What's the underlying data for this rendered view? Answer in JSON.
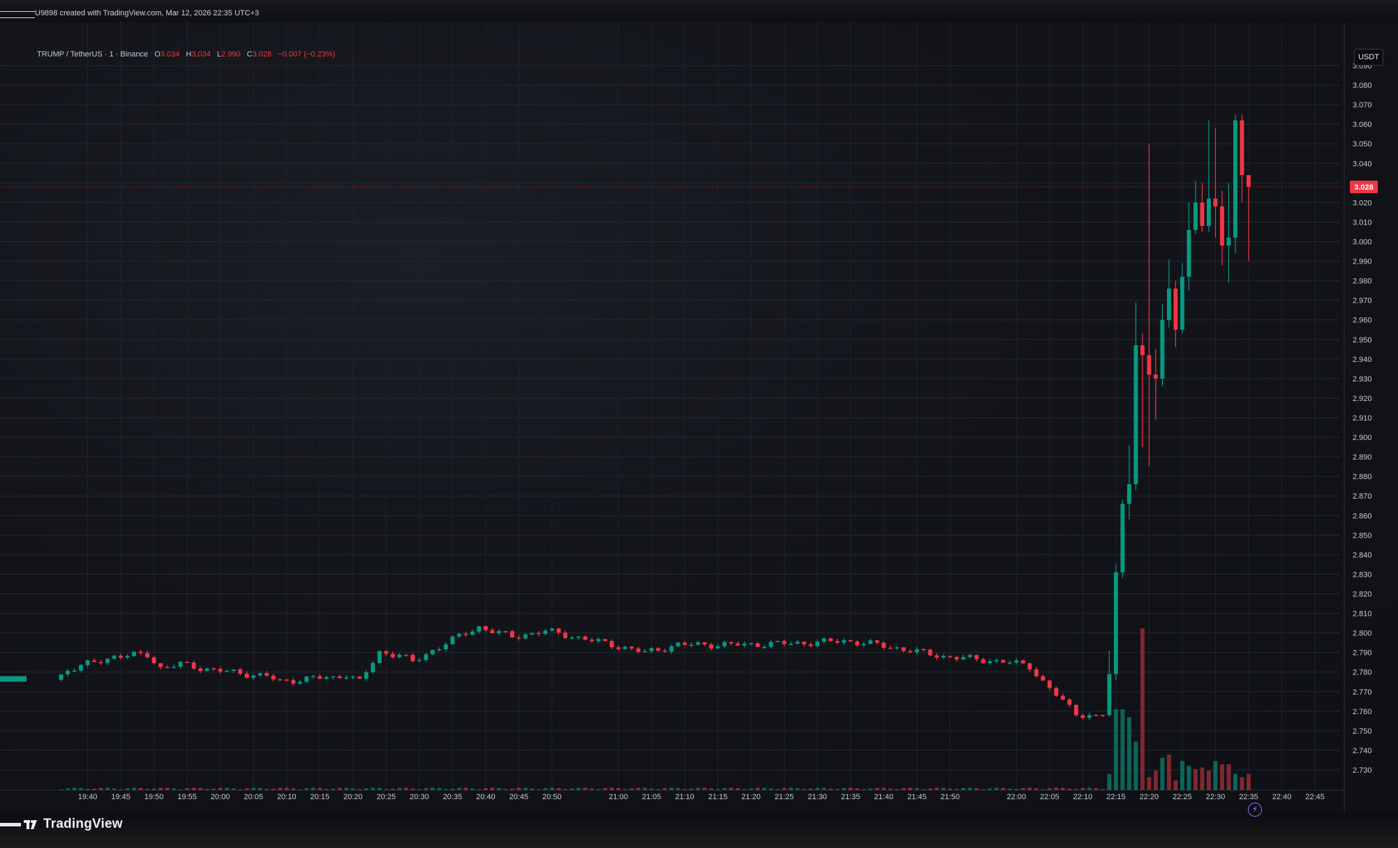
{
  "attribution": "U9898 created with TradingView.com, Mar 12, 2026 22:35 UTC+3",
  "legend": {
    "symbol": "TRUMP / TetherUS · 1 · Binance",
    "o_label": "O",
    "open": "3.034",
    "h_label": "H",
    "high": "3.034",
    "l_label": "L",
    "low": "2.990",
    "c_label": "C",
    "close": "3.028",
    "change": "−0.007 (−0.23%)"
  },
  "currency_button": "USDT",
  "brand": {
    "name": "TradingView"
  },
  "colors": {
    "up": "#089981",
    "down": "#f23645",
    "background": "#131722",
    "grid": "#262a33",
    "text": "#d1d4dc"
  },
  "icons": {
    "lightning": "lightning-icon",
    "logo": "tradingview-logo-icon"
  },
  "chart_data": {
    "type": "candlestick",
    "ylim": [
      2.725,
      3.095
    ],
    "y_ticks": [
      "3.090",
      "3.080",
      "3.070",
      "3.060",
      "3.050",
      "3.040",
      "3.030",
      "3.020",
      "3.010",
      "3.000",
      "2.990",
      "2.980",
      "2.970",
      "2.960",
      "2.950",
      "2.940",
      "2.930",
      "2.920",
      "2.910",
      "2.900",
      "2.890",
      "2.880",
      "2.870",
      "2.860",
      "2.850",
      "2.840",
      "2.830",
      "2.820",
      "2.810",
      "2.800",
      "2.790",
      "2.780",
      "2.770",
      "2.760",
      "2.750",
      "2.740",
      "2.730"
    ],
    "x_ticks": [
      "19:40",
      "19:45",
      "19:50",
      "19:55",
      "20:00",
      "20:05",
      "20:10",
      "20:15",
      "20:20",
      "20:25",
      "20:30",
      "20:35",
      "20:40",
      "20:45",
      "20:50",
      "21:00",
      "21:05",
      "21:10",
      "21:15",
      "21:20",
      "21:25",
      "21:30",
      "21:35",
      "21:40",
      "21:45",
      "21:50",
      "22:00",
      "22:05",
      "22:10",
      "22:15",
      "22:20",
      "22:25",
      "22:30",
      "22:35",
      "22:40",
      "22:45"
    ],
    "last_price": "3.028",
    "waypoints": [
      [
        "19:36",
        2.776
      ],
      [
        "19:38",
        2.781
      ],
      [
        "19:42",
        2.785
      ],
      [
        "19:45",
        2.788
      ],
      [
        "19:50",
        2.789
      ],
      [
        "19:52",
        2.782
      ],
      [
        "19:55",
        2.784
      ],
      [
        "20:00",
        2.781
      ],
      [
        "20:05",
        2.779
      ],
      [
        "20:08",
        2.778
      ],
      [
        "20:10",
        2.775
      ],
      [
        "20:15",
        2.777
      ],
      [
        "20:18",
        2.777
      ],
      [
        "20:20",
        2.779
      ],
      [
        "20:22",
        2.775
      ],
      [
        "20:25",
        2.79
      ],
      [
        "20:28",
        2.789
      ],
      [
        "20:30",
        2.785
      ],
      [
        "20:35",
        2.795
      ],
      [
        "20:40",
        2.803
      ],
      [
        "20:42",
        2.801
      ],
      [
        "20:45",
        2.798
      ],
      [
        "20:50",
        2.801
      ],
      [
        "20:53",
        2.799
      ],
      [
        "21:00",
        2.794
      ],
      [
        "21:05",
        2.79
      ],
      [
        "21:10",
        2.794
      ],
      [
        "21:20",
        2.794
      ],
      [
        "21:30",
        2.795
      ],
      [
        "21:35",
        2.796
      ],
      [
        "21:40",
        2.794
      ],
      [
        "21:45",
        2.791
      ],
      [
        "21:50",
        2.788
      ],
      [
        "22:00",
        2.785
      ],
      [
        "22:03",
        2.783
      ],
      [
        "22:05",
        2.775
      ],
      [
        "22:08",
        2.765
      ],
      [
        "22:10",
        2.759
      ],
      [
        "22:13",
        2.757
      ],
      [
        "22:14",
        2.758
      ]
    ],
    "candles": [
      {
        "t": "22:14",
        "o": 2.758,
        "h": 2.791,
        "l": 2.757,
        "c": 2.779
      },
      {
        "t": "22:15",
        "o": 2.779,
        "h": 2.835,
        "l": 2.776,
        "c": 2.831
      },
      {
        "t": "22:16",
        "o": 2.831,
        "h": 2.868,
        "l": 2.828,
        "c": 2.866
      },
      {
        "t": "22:17",
        "o": 2.866,
        "h": 2.896,
        "l": 2.858,
        "c": 2.876
      },
      {
        "t": "22:18",
        "o": 2.876,
        "h": 2.969,
        "l": 2.873,
        "c": 2.947
      },
      {
        "t": "22:19",
        "o": 2.947,
        "h": 2.953,
        "l": 2.895,
        "c": 2.942
      },
      {
        "t": "22:20",
        "o": 2.942,
        "h": 3.05,
        "l": 2.885,
        "c": 2.932
      },
      {
        "t": "22:21",
        "o": 2.932,
        "h": 2.945,
        "l": 2.909,
        "c": 2.93
      },
      {
        "t": "22:22",
        "o": 2.93,
        "h": 2.968,
        "l": 2.926,
        "c": 2.96
      },
      {
        "t": "22:23",
        "o": 2.96,
        "h": 2.991,
        "l": 2.956,
        "c": 2.976
      },
      {
        "t": "22:24",
        "o": 2.976,
        "h": 2.98,
        "l": 2.946,
        "c": 2.955
      },
      {
        "t": "22:25",
        "o": 2.955,
        "h": 2.989,
        "l": 2.953,
        "c": 2.982
      },
      {
        "t": "22:26",
        "o": 2.982,
        "h": 3.02,
        "l": 2.975,
        "c": 3.006
      },
      {
        "t": "22:27",
        "o": 3.006,
        "h": 3.031,
        "l": 3.004,
        "c": 3.02
      },
      {
        "t": "22:28",
        "o": 3.02,
        "h": 3.03,
        "l": 3.005,
        "c": 3.008
      },
      {
        "t": "22:29",
        "o": 3.008,
        "h": 3.062,
        "l": 3.005,
        "c": 3.022
      },
      {
        "t": "22:30",
        "o": 3.022,
        "h": 3.058,
        "l": 3.002,
        "c": 3.018
      },
      {
        "t": "22:31",
        "o": 3.018,
        "h": 3.026,
        "l": 2.988,
        "c": 2.998
      },
      {
        "t": "22:32",
        "o": 2.998,
        "h": 3.03,
        "l": 2.979,
        "c": 3.002
      },
      {
        "t": "22:33",
        "o": 3.002,
        "h": 3.065,
        "l": 2.994,
        "c": 3.062
      },
      {
        "t": "22:34",
        "o": 3.062,
        "h": 3.065,
        "l": 3.02,
        "c": 3.034
      },
      {
        "t": "22:35",
        "o": 3.034,
        "h": 3.034,
        "l": 2.99,
        "c": 3.028
      }
    ],
    "volume": {
      "spike": [
        {
          "t": "22:14",
          "up": true,
          "v": 0.1
        },
        {
          "t": "22:15",
          "up": true,
          "v": 0.5
        },
        {
          "t": "22:16",
          "up": true,
          "v": 0.5
        },
        {
          "t": "22:17",
          "up": true,
          "v": 0.45
        },
        {
          "t": "22:18",
          "up": true,
          "v": 0.3
        },
        {
          "t": "22:19",
          "up": false,
          "v": 1.0
        },
        {
          "t": "22:20",
          "up": false,
          "v": 0.08
        },
        {
          "t": "22:21",
          "up": false,
          "v": 0.12
        },
        {
          "t": "22:22",
          "up": true,
          "v": 0.2
        },
        {
          "t": "22:23",
          "up": false,
          "v": 0.22
        },
        {
          "t": "22:24",
          "up": false,
          "v": 0.06
        },
        {
          "t": "22:25",
          "up": true,
          "v": 0.18
        },
        {
          "t": "22:26",
          "up": true,
          "v": 0.15
        },
        {
          "t": "22:27",
          "up": false,
          "v": 0.13
        },
        {
          "t": "22:28",
          "up": false,
          "v": 0.14
        },
        {
          "t": "22:29",
          "up": false,
          "v": 0.12
        },
        {
          "t": "22:30",
          "up": true,
          "v": 0.18
        },
        {
          "t": "22:31",
          "up": false,
          "v": 0.16
        },
        {
          "t": "22:32",
          "up": false,
          "v": 0.16
        },
        {
          "t": "22:33",
          "up": true,
          "v": 0.1
        },
        {
          "t": "22:34",
          "up": false,
          "v": 0.08
        },
        {
          "t": "22:35",
          "up": false,
          "v": 0.1
        }
      ]
    }
  }
}
